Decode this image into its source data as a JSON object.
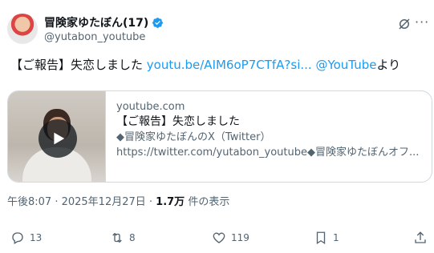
{
  "author": {
    "name": "冒険家ゆたぼん(17)",
    "handle": "@yutabon_youtube"
  },
  "tweet": {
    "prefix": "【ご報告】失恋しました ",
    "link1": "youtu.be/AIM6oP7CTfA?si...",
    "space": " ",
    "link2": "@YouTube",
    "suffix": "より"
  },
  "card": {
    "domain": "youtube.com",
    "title": "【ご報告】失恋しました",
    "desc1": "◆冒険家ゆたぼんのX（Twitter）",
    "desc2": "https://twitter.com/yutabon_youtube◆冒険家ゆたぼんオフ..."
  },
  "meta": {
    "time": "午後8:07 · 2025年12月27日 · ",
    "views": "1.7万",
    "views_suffix": " 件の表示"
  },
  "actions": {
    "replies": "13",
    "reposts": "8",
    "likes": "119",
    "bookmarks": "1"
  },
  "icons": {
    "verified": "verified-badge-icon",
    "grok": "grok-icon",
    "more": "more-icon",
    "reply": "reply-icon",
    "repost": "repost-icon",
    "like": "heart-icon",
    "bookmark": "bookmark-icon",
    "share": "share-icon",
    "play": "play-icon"
  },
  "colors": {
    "accent": "#1d9bf0",
    "text": "#0f1419",
    "muted": "#536471",
    "border": "#cfd9de"
  }
}
